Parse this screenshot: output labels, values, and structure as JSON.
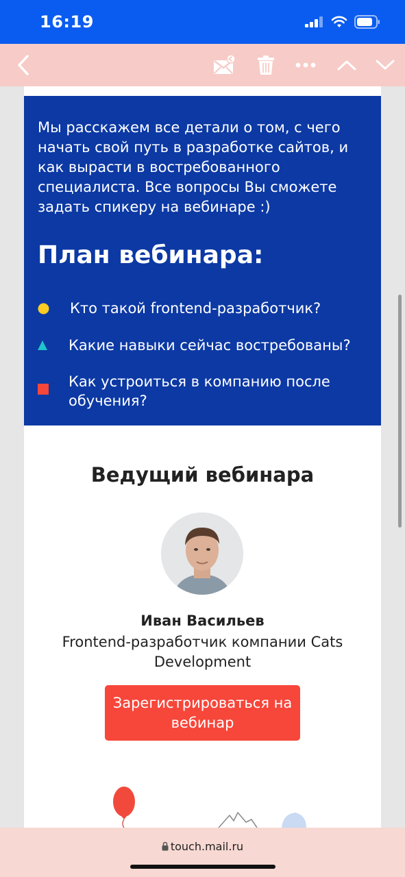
{
  "status_bar": {
    "time": "16:19"
  },
  "toolbar": {
    "icons": [
      "back-icon",
      "move-to-spam-icon",
      "trash-icon",
      "more-icon",
      "chevron-up-icon",
      "chevron-down-icon"
    ]
  },
  "intro": {
    "text": "Мы расскажем все детали о том, с чего начать свой путь в разработке сайтов, и как вырасти в востребованного специалиста. Все вопросы Вы сможете задать спикеру на вебинаре :)"
  },
  "plan": {
    "title": "План вебинара:",
    "items": [
      {
        "text": "Кто такой frontend-разработчик?",
        "marker": "yellow-circle",
        "color": "#ffcc22"
      },
      {
        "text": "Какие навыки сейчас востребованы?",
        "marker": "teal-triangle",
        "color": "#21c4c9"
      },
      {
        "text": "Как устроиться в компанию после обучения?",
        "marker": "red-square",
        "color": "#f7463a"
      }
    ]
  },
  "host": {
    "title": "Ведущий вебинара",
    "name": "Иван Васильев",
    "role": "Frontend-разработчик компании Cats Development"
  },
  "register_button": {
    "label": "Зарегистрироваться на вебинар",
    "color": "#f7463a"
  },
  "url_bar": {
    "url": "touch.mail.ru"
  },
  "colors": {
    "status_bar": "#0a5cf0",
    "toolbar": "#f7cbc7",
    "blue_block": "#0c39a4"
  }
}
